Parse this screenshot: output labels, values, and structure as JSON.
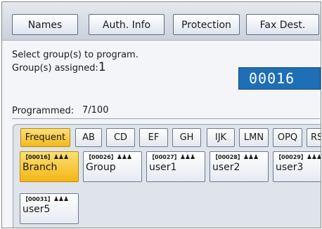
{
  "tabs": [
    {
      "label": "Names"
    },
    {
      "label": "Auth. Info"
    },
    {
      "label": "Protection"
    },
    {
      "label": "Fax Dest."
    }
  ],
  "prompt": {
    "instruction": "Select group(s) to program.",
    "assigned_label": "Group(s) assigned:",
    "assigned_count": "1",
    "selected_number": "00016"
  },
  "programmed": {
    "label": "Programmed:",
    "count": "7/100"
  },
  "index_tabs": [
    {
      "label": "Frequent",
      "active": true
    },
    {
      "label": "AB"
    },
    {
      "label": "CD"
    },
    {
      "label": "EF"
    },
    {
      "label": "GH"
    },
    {
      "label": "IJK"
    },
    {
      "label": "LMN"
    },
    {
      "label": "OPQ"
    },
    {
      "label": "RS"
    }
  ],
  "entries": [
    {
      "code": "【00016】",
      "name": "Branch",
      "selected": true
    },
    {
      "code": "【00026】",
      "name": "Group"
    },
    {
      "code": "【00027】",
      "name": "user1"
    },
    {
      "code": "【00028】",
      "name": "user2"
    },
    {
      "code": "【00029】",
      "name": "user3"
    },
    {
      "code": "【00031】",
      "name": "user5"
    }
  ],
  "group_icon": "group-people-icon",
  "colors": {
    "active_yellow": "#f3b91c",
    "selection_blue": "#1e6fb6"
  }
}
